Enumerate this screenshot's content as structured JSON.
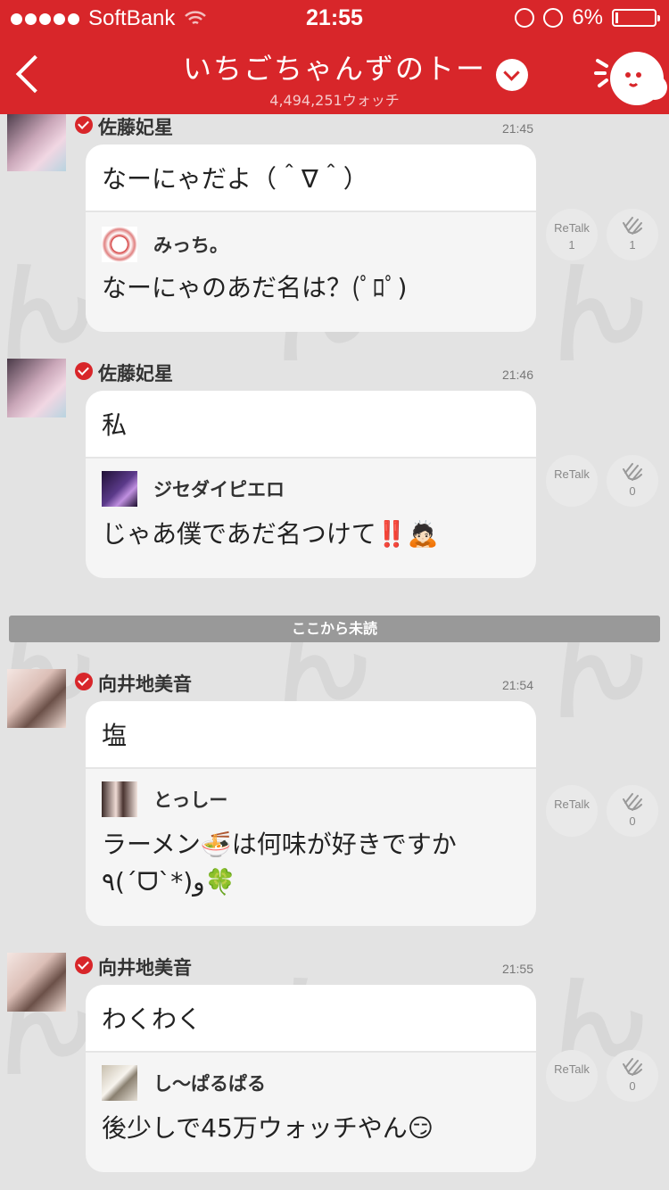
{
  "status": {
    "carrier": "SoftBank",
    "time": "21:55",
    "battery": "6%"
  },
  "header": {
    "title": "いちごちゃんずのトー",
    "watch_count": "4,494,251ウォッチ"
  },
  "unread_divider": "ここから未読",
  "retalk_label": "ReTalk",
  "messages": [
    {
      "poster": "佐藤妃星",
      "time": "21:45",
      "text": "なーにゃだよ（＾∇＾）",
      "reply_name": "みっち。",
      "reply_text": "なーにゃのあだ名は？(ﾟﾛﾟ)",
      "retalk_count": "1",
      "clap_count": "1"
    },
    {
      "poster": "佐藤妃星",
      "time": "21:46",
      "text": "私",
      "reply_name": "ジセダイピエロ",
      "reply_text": "じゃあ僕であだ名つけて‼️🙇🏻",
      "clap_count": "0"
    },
    {
      "poster": "向井地美音",
      "time": "21:54",
      "text": "塩",
      "reply_name": "とっしー",
      "reply_text": "ラーメン🍜は何味が好きですか٩(´ᗜ`*)و🍀",
      "clap_count": "0"
    },
    {
      "poster": "向井地美音",
      "time": "21:55",
      "text": "わくわく",
      "reply_name": "し〜ぱるぱる",
      "reply_text": "後少しで45万ウォッチやん😏",
      "clap_count": "0"
    }
  ]
}
